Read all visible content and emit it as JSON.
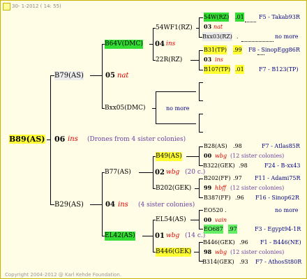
{
  "header": {
    "date_text": "30- 1-2012 ( 14: 55)"
  },
  "footer": {
    "copyright": "Copyright 2004-2012 @ Karl Kehde Foundation."
  },
  "colors": {
    "border": "#c9b400",
    "highlight_yellow": "#ffff33",
    "highlight_green": "#33dd33",
    "italic_red": "#e00000",
    "link_blue": "#2040c0"
  },
  "root": {
    "name": "B89(AS)",
    "year": "06",
    "note": "ins",
    "drones_text": "(Drones from 4 sister colonies)"
  },
  "father": {
    "name": "B79(AS)",
    "year": "05",
    "note": "nat",
    "left": {
      "name": "B64V(DMC)",
      "year": "04",
      "note": "ins",
      "top": {
        "name": "54WF1(RZ)"
      },
      "bottom": {
        "name": "22R(RZ)"
      },
      "g1": {
        "name": "54W(RZ)",
        "year": ".01",
        "ref": "F5 - Takab93R"
      },
      "g2": {
        "year": "03",
        "note": "nat"
      },
      "g3": {
        "name": "Bxx03(RZ)",
        "dot": ".",
        "ref": "no more"
      },
      "g4": {
        "name": "B31(TP)",
        "year": ".99",
        "ref": "F8 - SinopEgg86R"
      },
      "g5": {
        "year": "03",
        "note": "ins"
      },
      "g6": {
        "name": "B107(TP)",
        "year": ".01",
        "ref": "F7 - B123(TP)"
      }
    },
    "right": {
      "name": "Bxx05(DMC)",
      "ref": "no more"
    }
  },
  "mother": {
    "name": "B29(AS)",
    "year": "04",
    "note": "ins",
    "sisters_text": "(4 sister colonies)",
    "left": {
      "name": "B77(AS)",
      "top": {
        "name": "B49(AS)"
      },
      "mid": {
        "year": "02",
        "note": "wbg",
        "count": "(20 c.)"
      },
      "bottom": {
        "name": "B202(GEK)"
      },
      "g1": {
        "name": "B28(AS)",
        "year": ".98",
        "ref": "F7 - Atlas85R"
      },
      "g2": {
        "year": "00",
        "note": "wbg",
        "count": "(12 sister colonies)"
      },
      "g3": {
        "name": "B322(GEK)",
        "year": ".98",
        "ref": "F24 - B-xx43"
      },
      "g4": {
        "name": "B202(FF)",
        "year": ".97",
        "ref": "F11 - Adami75R"
      },
      "g5": {
        "year": "99",
        "note": "hbff",
        "count": "(12 sister colonies)"
      },
      "g6": {
        "name": "B387(FF)",
        "year": ".96",
        "ref": "F16 - Sinop62R"
      }
    },
    "right": {
      "name": "EL42(AS)",
      "top": {
        "name": "EL54(AS)"
      },
      "mid": {
        "year": "01",
        "note": "wbg",
        "count": "(14 c.)"
      },
      "bottom": {
        "name": "B446(GEK)"
      },
      "g1": {
        "name": "EO520",
        "dot": ".",
        "ref": "no more"
      },
      "g2": {
        "year": "00",
        "note": "vain"
      },
      "g3": {
        "name": "EO687",
        "year": ".97",
        "ref": "F3 - Egypt94-1R"
      },
      "g4": {
        "name": "B446(GEK)",
        "year": ".96",
        "ref": "F1 - B446(NE)"
      },
      "g5": {
        "year": "98",
        "note": "wbg",
        "count": "(12 sister colonies)"
      },
      "g6": {
        "name": "B314(GEK)",
        "year": ".93",
        "ref": "F7 - AthosSt80R"
      }
    }
  }
}
